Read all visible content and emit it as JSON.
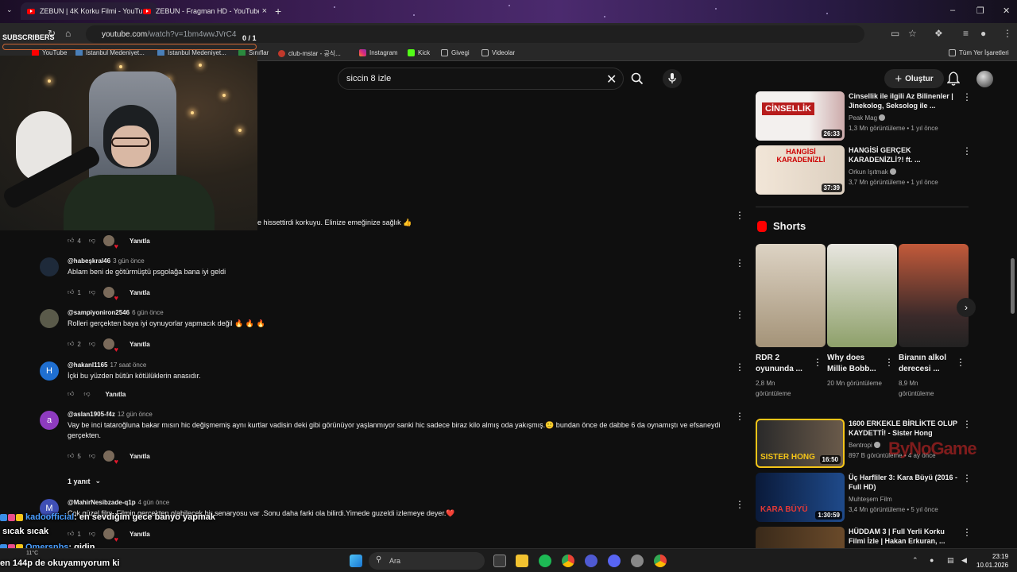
{
  "tabs": [
    {
      "title": "ZEBUN | 4K Korku Filmi - YouTube",
      "active": true
    },
    {
      "title": "ZEBUN - Fragman HD - YouTube",
      "active": false
    }
  ],
  "address": {
    "host": "youtube.com",
    "path": "/watch?v=1bm4wwJVrC4"
  },
  "bookmarks": [
    "YouTube",
    "İstanbul Medeniyet...",
    "İstanbul Medeniyet...",
    "Sınıflar",
    "club-mstar - 공식...",
    "Instagram",
    "Kick",
    "Givegi",
    "Videolar"
  ],
  "bookmarks_all": "Tüm Yer İşaretleri",
  "search": {
    "value": "siccin 8 izle"
  },
  "header": {
    "create_label": "Oluştur"
  },
  "overlay": {
    "subscribers_label": "SUBSCRIBERS",
    "subscribers_count": "0 / 1"
  },
  "comments": [
    {
      "author": "",
      "time": "",
      "text": "e hissettirdi korkuyu. Elinize emeğinize sağlık 👍",
      "likes": "4",
      "reply": "Yanıtla"
    },
    {
      "author": "@habeşkral46",
      "time": "3 gün önce",
      "text": "Ablam beni de götürmüştü psgolağa bana iyi geldi",
      "likes": "1",
      "reply": "Yanıtla"
    },
    {
      "author": "@sampiyoniron2546",
      "time": "6 gün önce",
      "text": "Rolleri gerçekten baya iyi oynuyorlar yapmacık değil 🔥 🔥 🔥",
      "likes": "2",
      "reply": "Yanıtla"
    },
    {
      "author": "@hakanl1165",
      "time": "17 saat önce",
      "text": "İçki bu yüzden bütün kötülüklerin anasıdır.",
      "likes": "",
      "reply": "Yanıtla",
      "avatar_letter": "H"
    },
    {
      "author": "@aslan1905-f4z",
      "time": "12 gün önce",
      "text": "Vay be inci tataroğluna bakar mısın hic değişmemiş aynı kurtlar vadisin deki gibi görünüyor yaşlanmıyor sanki hic sadece biraz kilo almış oda yakışmış.🙂 bundan önce de dabbe 6 da oynamıştı ve efsaneydi gerçekten.",
      "likes": "5",
      "reply": "Yanıtla",
      "avatar_letter": "a"
    },
    {
      "author": "@MahirNesibzade-q1p",
      "time": "4 gün önce",
      "text": "Çok güzel film. Filmin gerçekten olabilecek bir senaryosu var .Sonu daha farki ola bilirdi.Yimede guzeldi izlemeye deyer.❤️",
      "likes": "1",
      "reply": "Yanıtla",
      "avatar_letter": "M"
    }
  ],
  "replies_toggle": "1 yanıt",
  "chat": [
    {
      "name": "kadoofficial",
      "text": ": en sevdiğim gece banyo yapmak"
    },
    {
      "name": "",
      "text": "sıcak sıcak"
    },
    {
      "name": "Omersnbs",
      "text": ": gidin"
    },
    {
      "name": "",
      "text": "en 144p de okuyamıyorum ki"
    }
  ],
  "sidebar_top": [
    {
      "title": "Cinsellik ile ilgili Az Bilinenler | Jinekolog, Seksolog ile ...",
      "channel": "Peak Mag",
      "meta": "1,3 Mn görüntüleme • 1 yıl önce",
      "duration": "26:33",
      "thumb_text": "CİNSELLİK"
    },
    {
      "title": "HANGİSİ GERÇEK KARADENİZLİ?! ft. ...",
      "channel": "Orkun Işıtmak",
      "meta": "3,7 Mn görüntüleme • 1 yıl önce",
      "duration": "37:39",
      "thumb_text": "HANGİSİ KARADENİZLİ"
    }
  ],
  "shorts_title": "Shorts",
  "shorts": [
    {
      "title": "RDR 2 oyununda ...",
      "views": "2,8 Mn görüntüleme"
    },
    {
      "title": "Why does Millie Bobb...",
      "views": "20 Mn görüntüleme"
    },
    {
      "title": "Biranın alkol derecesi ...",
      "views": "8,9 Mn görüntüleme"
    }
  ],
  "sidebar_bottom": [
    {
      "title": "1600 ERKEKLE BİRLİKTE OLUP KAYDETTİ! - Sister Hong",
      "channel": "Bentropi",
      "meta": "897 B görüntüleme • 4 ay önce",
      "duration": "16:50",
      "thumb_text": "SISTER HONG"
    },
    {
      "title": "Üç Harfliler 3: Kara Büyü (2016 - Full HD)",
      "channel": "Muhteşem Film",
      "meta": "3,4 Mn görüntüleme • 5 yıl önce",
      "duration": "1:30:59",
      "thumb_text": "KARA BÜYÜ"
    },
    {
      "title": "HÜDDAM 3 | Full Yerli Korku Filmi İzle | Hakan Erkuran, ...",
      "channel": "",
      "meta": "",
      "duration": "",
      "thumb_text": ""
    }
  ],
  "watermark": "ByNoGame",
  "taskbar": {
    "search_placeholder": "Ara",
    "time": "23:19",
    "date": "10.01.2026",
    "weather": "11°C"
  },
  "colors": {
    "accent": "#ff0000",
    "background": "#0f0f0f",
    "chat_name": "#4a9eff"
  }
}
